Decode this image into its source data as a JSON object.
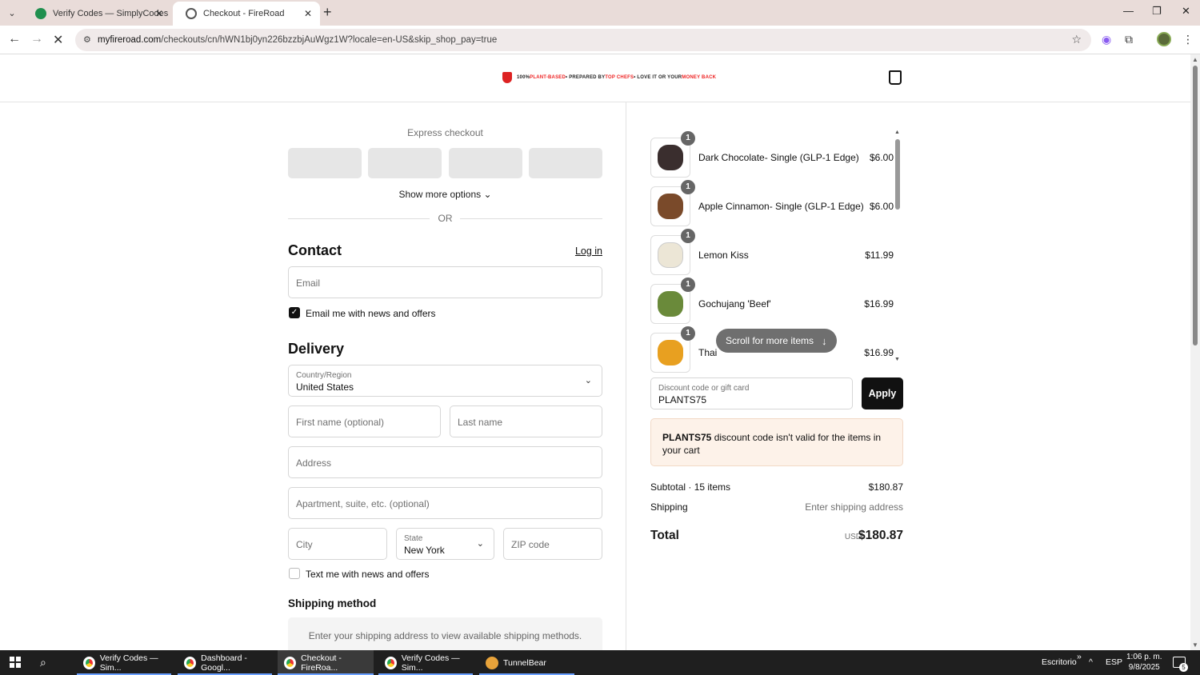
{
  "browser": {
    "tabs": [
      {
        "title": "Verify Codes — SimplyCodes",
        "active": false
      },
      {
        "title": "Checkout - FireRoad",
        "active": true
      }
    ],
    "url_host": "myfireroad.com",
    "url_path": "/checkouts/cn/hWN1bj0yn226bzzbjAuWgz1W?locale=en-US&skip_shop_pay=true"
  },
  "header": {
    "promo_part1": "100% ",
    "promo_red1": "PLANT-BASED",
    "promo_part2": " • PREPARED BY ",
    "promo_red2": "TOP CHEFS",
    "promo_part3": " • LOVE IT OR YOUR ",
    "promo_red3": "MONEY BACK"
  },
  "checkout": {
    "express_title": "Express checkout",
    "show_more": "Show more options ⌄",
    "or": "OR",
    "contact_title": "Contact",
    "login": "Log in",
    "email_placeholder": "Email",
    "email_news": "Email me with news and offers",
    "delivery_title": "Delivery",
    "country_label": "Country/Region",
    "country_value": "United States",
    "first_name_placeholder": "First name (optional)",
    "last_name_placeholder": "Last name",
    "address_placeholder": "Address",
    "apartment_placeholder": "Apartment, suite, etc. (optional)",
    "city_placeholder": "City",
    "state_label": "State",
    "state_value": "New York",
    "zip_placeholder": "ZIP code",
    "text_news": "Text me with news and offers",
    "shipping_method_title": "Shipping method",
    "shipping_method_note": "Enter your shipping address to view available shipping methods."
  },
  "summary": {
    "items": [
      {
        "qty": "1",
        "name": "Dark Chocolate- Single (GLP-1 Edge)",
        "price": "$6.00",
        "color": "#3a2e2e"
      },
      {
        "qty": "1",
        "name": "Apple Cinnamon- Single (GLP-1 Edge)",
        "price": "$6.00",
        "color": "#7a4a2a"
      },
      {
        "qty": "1",
        "name": "Lemon Kiss",
        "price": "$11.99",
        "color": "#ece6d6"
      },
      {
        "qty": "1",
        "name": "Gochujang 'Beef'",
        "price": "$16.99",
        "color": "#6a8a3a"
      },
      {
        "qty": "1",
        "name": "Thai",
        "price": "$16.99",
        "color": "#e8a020"
      }
    ],
    "scroll_hint": "Scroll for more items",
    "discount_label": "Discount code or gift card",
    "discount_value": "PLANTS75",
    "apply": "Apply",
    "alert_code": "PLANTS75",
    "alert_text": " discount code isn't valid for the items in your cart",
    "subtotal_label": "Subtotal · 15 items",
    "subtotal_value": "$180.87",
    "shipping_label": "Shipping",
    "shipping_value": "Enter shipping address",
    "total_label": "Total",
    "total_currency": "USD",
    "total_value": "$180.87"
  },
  "taskbar": {
    "apps": [
      {
        "label": "Verify Codes — Sim...",
        "active": false
      },
      {
        "label": "Dashboard - Googl...",
        "active": false
      },
      {
        "label": "Checkout - FireRoa...",
        "active": true
      },
      {
        "label": "Verify Codes — Sim...",
        "active": false
      },
      {
        "label": "TunnelBear",
        "active": false
      }
    ],
    "desktop": "Escritorio",
    "lang": "ESP",
    "time": "1:06 p. m.",
    "date": "9/8/2025",
    "notifications": "5"
  }
}
